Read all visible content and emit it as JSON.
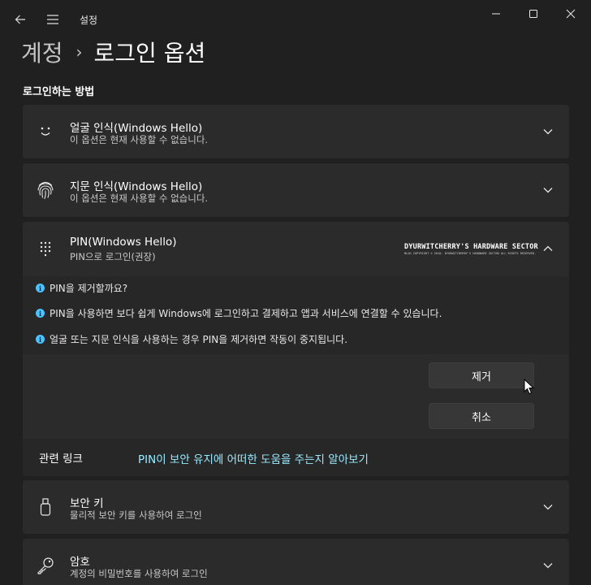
{
  "window": {
    "app_title": "설정",
    "back_icon": "back-arrow-icon",
    "menu_icon": "hamburger-menu-icon"
  },
  "breadcrumb": {
    "parent": "계정",
    "separator": "›",
    "current": "로그인 옵션"
  },
  "section_title": "로그인하는 방법",
  "options": {
    "face": {
      "icon": "smiley-face-icon",
      "title": "얼굴 인식(Windows Hello)",
      "subtitle": "이 옵션은 현재 사용할 수 없습니다.",
      "expanded": false
    },
    "fingerprint": {
      "icon": "fingerprint-icon",
      "title": "지문 인식(Windows Hello)",
      "subtitle": "이 옵션은 현재 사용할 수 없습니다.",
      "expanded": false
    },
    "pin": {
      "icon": "keypad-icon",
      "title": "PIN(Windows Hello)",
      "subtitle": "PIN으로 로그인(권장)",
      "expanded": true,
      "watermark_main": "DYURWITCHERRY'S HARDWARE SECTOR",
      "watermark_sub": "BLOG COPYRIGHT © 2010. DYURWITCHERRY'S HARDWARE SECTOR ALL RIGHTS RESERVED.",
      "info": [
        "PIN을 제거할까요?",
        "PIN을 사용하면 보다 쉽게 Windows에 로그인하고 결제하고 앱과 서비스에 연결할 수 있습니다.",
        "얼굴 또는 지문 인식을 사용하는 경우 PIN을 제거하면 작동이 중지됩니다."
      ],
      "remove_button": "제거",
      "cancel_button": "취소",
      "related_label": "관련 링크",
      "related_link": "PIN이 보안 유지에 어떠한 도움을 주는지 알아보기"
    },
    "security_key": {
      "icon": "usb-key-icon",
      "title": "보안 키",
      "subtitle": "물리적 보안 키를 사용하여 로그인",
      "expanded": false
    },
    "password": {
      "icon": "key-icon",
      "title": "암호",
      "subtitle": "계정의 비밀번호를 사용하여 로그인",
      "expanded": false
    }
  },
  "colors": {
    "background": "#202020",
    "card": "#2b2b2b",
    "accent": "#4cc2ff",
    "link": "#99ebff"
  }
}
